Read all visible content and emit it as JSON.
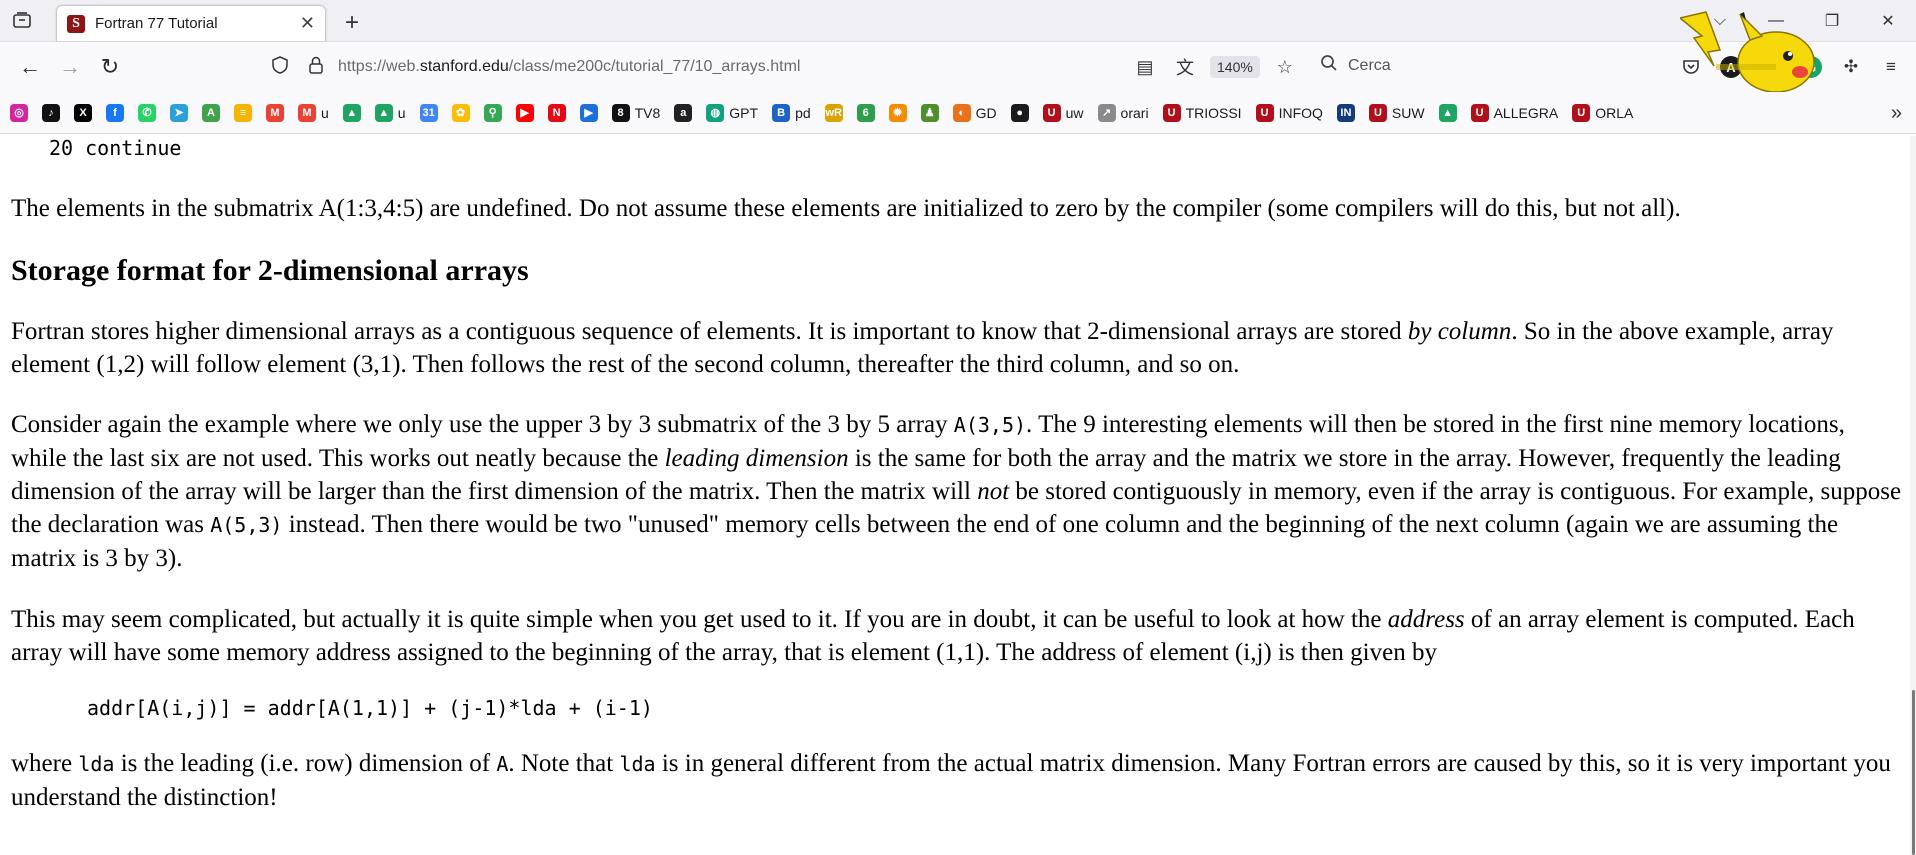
{
  "tab": {
    "title": "Fortran 77 Tutorial",
    "favicon_letter": "S",
    "close_glyph": "✕",
    "new_tab_glyph": "+"
  },
  "window": {
    "list_all_tabs_glyph": "⌵",
    "minimize_glyph": "—",
    "restore_glyph": "❐",
    "close_glyph": "✕"
  },
  "nav": {
    "back_glyph": "←",
    "forward_glyph": "→",
    "reload_glyph": "↻",
    "url_prefix": "https://web.",
    "url_host": "stanford.edu",
    "url_path": "/class/me200c/tutorial_77/10_arrays.html",
    "zoom": "140%",
    "search_placeholder": "Cerca"
  },
  "bookmarks": [
    {
      "label": "",
      "icon": "instagram-icon",
      "color": "#d6249f",
      "glyph": "◎"
    },
    {
      "label": "",
      "icon": "tiktok-icon",
      "color": "#111111",
      "glyph": "♪"
    },
    {
      "label": "",
      "icon": "x-icon",
      "color": "#000000",
      "glyph": "X"
    },
    {
      "label": "",
      "icon": "facebook-icon",
      "color": "#1877f2",
      "glyph": "f"
    },
    {
      "label": "",
      "icon": "whatsapp-icon",
      "color": "#25d366",
      "glyph": "✆"
    },
    {
      "label": "",
      "icon": "telegram-icon",
      "color": "#2aa1da",
      "glyph": "➤"
    },
    {
      "label": "",
      "icon": "ao3-icon",
      "color": "#3ea34a",
      "glyph": "A"
    },
    {
      "label": "",
      "icon": "notes-icon",
      "color": "#f4b400",
      "glyph": "≡"
    },
    {
      "label": "",
      "icon": "gmail-icon",
      "color": "#ea4335",
      "glyph": "M"
    },
    {
      "label": "u",
      "icon": "gmail-icon",
      "color": "#ea4335",
      "glyph": "M"
    },
    {
      "label": "",
      "icon": "drive-icon",
      "color": "#1fa463",
      "glyph": "▲"
    },
    {
      "label": "u",
      "icon": "drive-icon",
      "color": "#1fa463",
      "glyph": "▲"
    },
    {
      "label": "",
      "icon": "calendar-icon",
      "color": "#4285f4",
      "glyph": "31"
    },
    {
      "label": "",
      "icon": "photos-icon",
      "color": "#fbbc04",
      "glyph": "✿"
    },
    {
      "label": "",
      "icon": "maps-icon",
      "color": "#34a853",
      "glyph": "⚲"
    },
    {
      "label": "",
      "icon": "youtube-icon",
      "color": "#ff0000",
      "glyph": "▶"
    },
    {
      "label": "",
      "icon": "netflix-icon",
      "color": "#e50914",
      "glyph": "N"
    },
    {
      "label": "",
      "icon": "play-icon",
      "color": "#1e6fd9",
      "glyph": "▶"
    },
    {
      "label": "TV8",
      "icon": "tv8-icon",
      "color": "#111111",
      "glyph": "8"
    },
    {
      "label": "",
      "icon": "amazon-icon",
      "color": "#222222",
      "glyph": "a"
    },
    {
      "label": "GPT",
      "icon": "openai-icon",
      "color": "#10a37f",
      "glyph": "◍"
    },
    {
      "label": "pd",
      "icon": "pd-icon",
      "color": "#1f63c6",
      "glyph": "B"
    },
    {
      "label": "",
      "icon": "wordreference-icon",
      "color": "#d9a300",
      "glyph": "wR"
    },
    {
      "label": "",
      "icon": "leaf-icon",
      "color": "#2e9e4d",
      "glyph": "6"
    },
    {
      "label": "",
      "icon": "gear-orange-icon",
      "color": "#f28c00",
      "glyph": "✹"
    },
    {
      "label": "",
      "icon": "figure-icon",
      "color": "#4d8f2a",
      "glyph": "♟"
    },
    {
      "label": "GD",
      "icon": "gd-icon",
      "color": "#e8711a",
      "glyph": "◐"
    },
    {
      "label": "",
      "icon": "github-icon",
      "color": "#1b1b1b",
      "glyph": "●"
    },
    {
      "label": "uw",
      "icon": "shield-uni-icon",
      "color": "#b0101c",
      "glyph": "U"
    },
    {
      "label": "orari",
      "icon": "link-icon",
      "color": "#8a8a8a",
      "glyph": "↗"
    },
    {
      "label": "TRIOSSI",
      "icon": "shield-uni-icon",
      "color": "#b0101c",
      "glyph": "U"
    },
    {
      "label": "INFOQ",
      "icon": "shield-uni-icon",
      "color": "#b0101c",
      "glyph": "U"
    },
    {
      "label": "",
      "icon": "infn-icon",
      "color": "#143b7a",
      "glyph": "IN"
    },
    {
      "label": "SUW",
      "icon": "shield-uni-icon",
      "color": "#b0101c",
      "glyph": "U"
    },
    {
      "label": "",
      "icon": "drive-icon",
      "color": "#1fa463",
      "glyph": "▲"
    },
    {
      "label": "ALLEGRA",
      "icon": "shield-uni-icon",
      "color": "#b0101c",
      "glyph": "U"
    },
    {
      "label": "ORLA",
      "icon": "shield-uni-icon",
      "color": "#b0101c",
      "glyph": "U"
    }
  ],
  "bookmarks_more_glyph": "»",
  "toolbar_glyphs": {
    "reader": "▤",
    "translate": "文",
    "star": "☆",
    "search": "⚲",
    "pocket": "◡",
    "account": "A",
    "w_ext": "W",
    "grammarly": "G",
    "extensions": "✣",
    "menu": "≡"
  },
  "content": {
    "code_top": "20 continue",
    "p1": "The elements in the submatrix A(1:3,4:5) are undefined. Do not assume these elements are initialized to zero by the compiler (some compilers will do this, but not all).",
    "h2": "Storage format for 2-dimensional arrays",
    "p2_a": "Fortran stores higher dimensional arrays as a contiguous sequence of elements. It is important to know that 2-dimensional arrays are stored ",
    "p2_em": "by column",
    "p2_b": ". So in the above example, array element (1,2) will follow element (3,1). Then follows the rest of the second column, thereafter the third column, and so on.",
    "p3_a": "Consider again the example where we only use the upper 3 by 3 submatrix of the 3 by 5 array ",
    "p3_code1": "A(3,5)",
    "p3_b": ". The 9 interesting elements will then be stored in the first nine memory locations, while the last six are not used. This works out neatly because the ",
    "p3_em1": "leading dimension",
    "p3_c": " is the same for both the array and the matrix we store in the array. However, frequently the leading dimension of the array will be larger than the first dimension of the matrix. Then the matrix will ",
    "p3_em2": "not",
    "p3_d": " be stored contiguously in memory, even if the array is contiguous. For example, suppose the declaration was ",
    "p3_code2": "A(5,3)",
    "p3_e": " instead. Then there would be two \"unused\" memory cells between the end of one column and the beginning of the next column (again we are assuming the matrix is 3 by 3).",
    "p4_a": "This may seem complicated, but actually it is quite simple when you get used to it. If you are in doubt, it can be useful to look at how the ",
    "p4_em": "address",
    "p4_b": " of an array element is computed. Each array will have some memory address assigned to the beginning of the array, that is element (1,1). The address of element (i,j) is then given by",
    "formula": "addr[A(i,j)] = addr[A(1,1)] + (j-1)*lda + (i-1)",
    "p5_a": "where ",
    "p5_code1": "lda",
    "p5_b": " is the leading (i.e. row) dimension of ",
    "p5_code2": "A",
    "p5_c": ". Note that ",
    "p5_code3": "lda",
    "p5_d": " is in general different from the actual matrix dimension. Many Fortran errors are caused by this, so it is very important you understand the distinction!"
  }
}
